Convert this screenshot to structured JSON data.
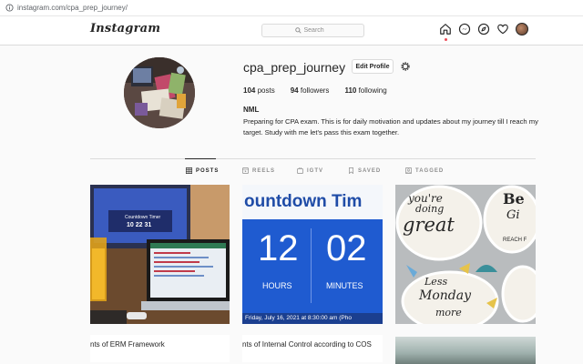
{
  "browser": {
    "url": "instagram.com/cpa_prep_journey/"
  },
  "header": {
    "logo": "Instagram",
    "search_placeholder": "Search"
  },
  "profile": {
    "username": "cpa_prep_journey",
    "edit_label": "Edit Profile",
    "stats": {
      "posts": {
        "count": "104",
        "label": "posts"
      },
      "followers": {
        "count": "94",
        "label": "followers"
      },
      "following": {
        "count": "110",
        "label": "following"
      }
    },
    "full_name": "NML",
    "bio": "Preparing for CPA exam. This is for daily motivation and updates about my journey till I reach my target. Study with me let's pass this exam together."
  },
  "tabs": [
    {
      "label": "POSTS",
      "active": true
    },
    {
      "label": "REELS",
      "active": false
    },
    {
      "label": "IGTV",
      "active": false
    },
    {
      "label": "SAVED",
      "active": false
    },
    {
      "label": "TAGGED",
      "active": false
    }
  ],
  "posts": [
    {
      "caption": "nts of ERM Framework",
      "screen_text": "Countdown Timer",
      "screen_time": "10 22 31"
    },
    {
      "caption": "nts of Internal Control according to COS",
      "title": "ountdown Tim",
      "hours": "12",
      "minutes": "02",
      "hours_label": "HOURS",
      "minutes_label": "MINUTES",
      "date": "Friday, July 16, 2021 at 8:30:00 am (Pho"
    },
    {
      "sticker_words": [
        "you're",
        "doing",
        "great",
        "Less",
        "Monday",
        "more",
        "Be",
        "Gi",
        "REACH F"
      ]
    }
  ],
  "colors": {
    "accent_blue": "#1f5bd0",
    "notification_red": "#ed4956",
    "border": "#dbdbdb",
    "text_primary": "#262626",
    "text_secondary": "#8e8e8e"
  }
}
